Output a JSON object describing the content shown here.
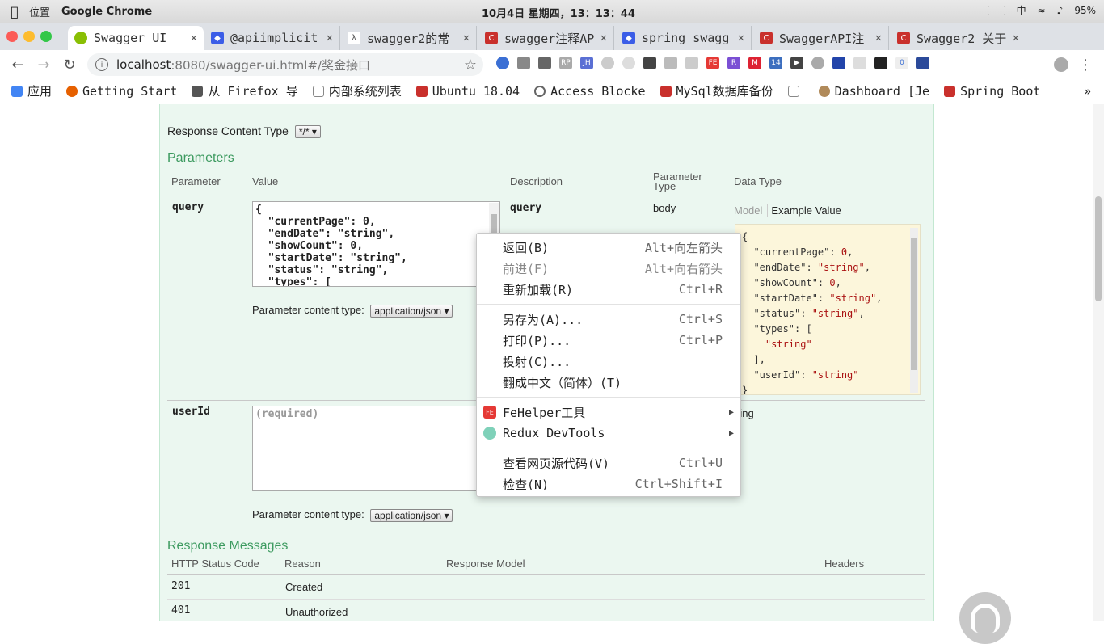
{
  "system": {
    "location": "位置",
    "app": "Google Chrome",
    "clock": "10月4日 星期四，13：13：44",
    "ime": "中",
    "battery": "95%"
  },
  "tabs": [
    {
      "label": "Swagger UI",
      "fav_color": "#89bf04"
    },
    {
      "label": "@apiimplicit",
      "fav_color": "#3b5de7"
    },
    {
      "label": "swagger2的常",
      "fav_color": "#555555"
    },
    {
      "label": "swagger注释AP",
      "fav_color": "#c9302c"
    },
    {
      "label": "spring swagg",
      "fav_color": "#3b5de7"
    },
    {
      "label": "SwaggerAPI注",
      "fav_color": "#c9302c"
    },
    {
      "label": "Swagger2 关于",
      "fav_color": "#c9302c"
    }
  ],
  "toolbar": {
    "url_host": "localhost",
    "url_path": ":8080/swagger-ui.html#/奖金接口"
  },
  "bookmarks": [
    {
      "label": "应用",
      "color": "#4285f4"
    },
    {
      "label": "Getting Start",
      "color": "#e66000"
    },
    {
      "label": "从 Firefox 导",
      "color": "#555555"
    },
    {
      "label": "内部系统列表",
      "color": "#888888"
    },
    {
      "label": "Ubuntu 18.04",
      "color": "#c9302c"
    },
    {
      "label": "Access Blocke",
      "color": "#666666"
    },
    {
      "label": "MySql数据库备份",
      "color": "#c9302c"
    },
    {
      "label": "",
      "color": "#888888"
    },
    {
      "label": "Dashboard [Je",
      "color": "#b08a5a"
    },
    {
      "label": "Spring Boot",
      "color": "#c9302c"
    }
  ],
  "page": {
    "response_content_type_label": "Response Content Type",
    "response_content_type_value": "*/*",
    "parameters_title": "Parameters",
    "columns": {
      "parameter": "Parameter",
      "value": "Value",
      "description": "Description",
      "param_type": "Parameter\nType",
      "data_type": "Data Type"
    },
    "query_row": {
      "name": "query",
      "value": "{\n  \"currentPage\": 0,\n  \"endDate\": \"string\",\n  \"showCount\": 0,\n  \"startDate\": \"string\",\n  \"status\": \"string\",\n  \"types\": [",
      "content_type_label": "Parameter content type:",
      "content_type_value": "application/json",
      "description": "query",
      "param_type": "body",
      "model_tab": "Model",
      "example_tab": "Example Value"
    },
    "userid_row": {
      "name": "userId",
      "placeholder": "(required)",
      "content_type_label": "Parameter content type:",
      "content_type_value": "application/json",
      "data_type": "ring"
    },
    "response_messages_title": "Response Messages",
    "response_columns": {
      "code": "HTTP Status Code",
      "reason": "Reason",
      "model": "Response Model",
      "headers": "Headers"
    },
    "responses": [
      {
        "code": "201",
        "reason": "Created"
      },
      {
        "code": "401",
        "reason": "Unauthorized"
      }
    ]
  },
  "context_menu": {
    "items": [
      {
        "label": "返回(B)",
        "shortcut": "Alt+向左箭头",
        "disabled": false
      },
      {
        "label": "前进(F)",
        "shortcut": "Alt+向右箭头",
        "disabled": true
      },
      {
        "label": "重新加载(R)",
        "shortcut": "Ctrl+R",
        "disabled": false
      },
      {
        "label": "另存为(A)...",
        "shortcut": "Ctrl+S",
        "disabled": false
      },
      {
        "label": "打印(P)...",
        "shortcut": "Ctrl+P",
        "disabled": false
      },
      {
        "label": "投射(C)...",
        "shortcut": "",
        "disabled": false
      },
      {
        "label": "翻成中文（简体）(T)",
        "shortcut": "",
        "disabled": false
      },
      {
        "label": "FeHelper工具",
        "shortcut": "",
        "disabled": false
      },
      {
        "label": "Redux DevTools",
        "shortcut": "",
        "disabled": false
      },
      {
        "label": "查看网页源代码(V)",
        "shortcut": "Ctrl+U",
        "disabled": false
      },
      {
        "label": "检查(N)",
        "shortcut": "Ctrl+Shift+I",
        "disabled": false
      }
    ]
  }
}
